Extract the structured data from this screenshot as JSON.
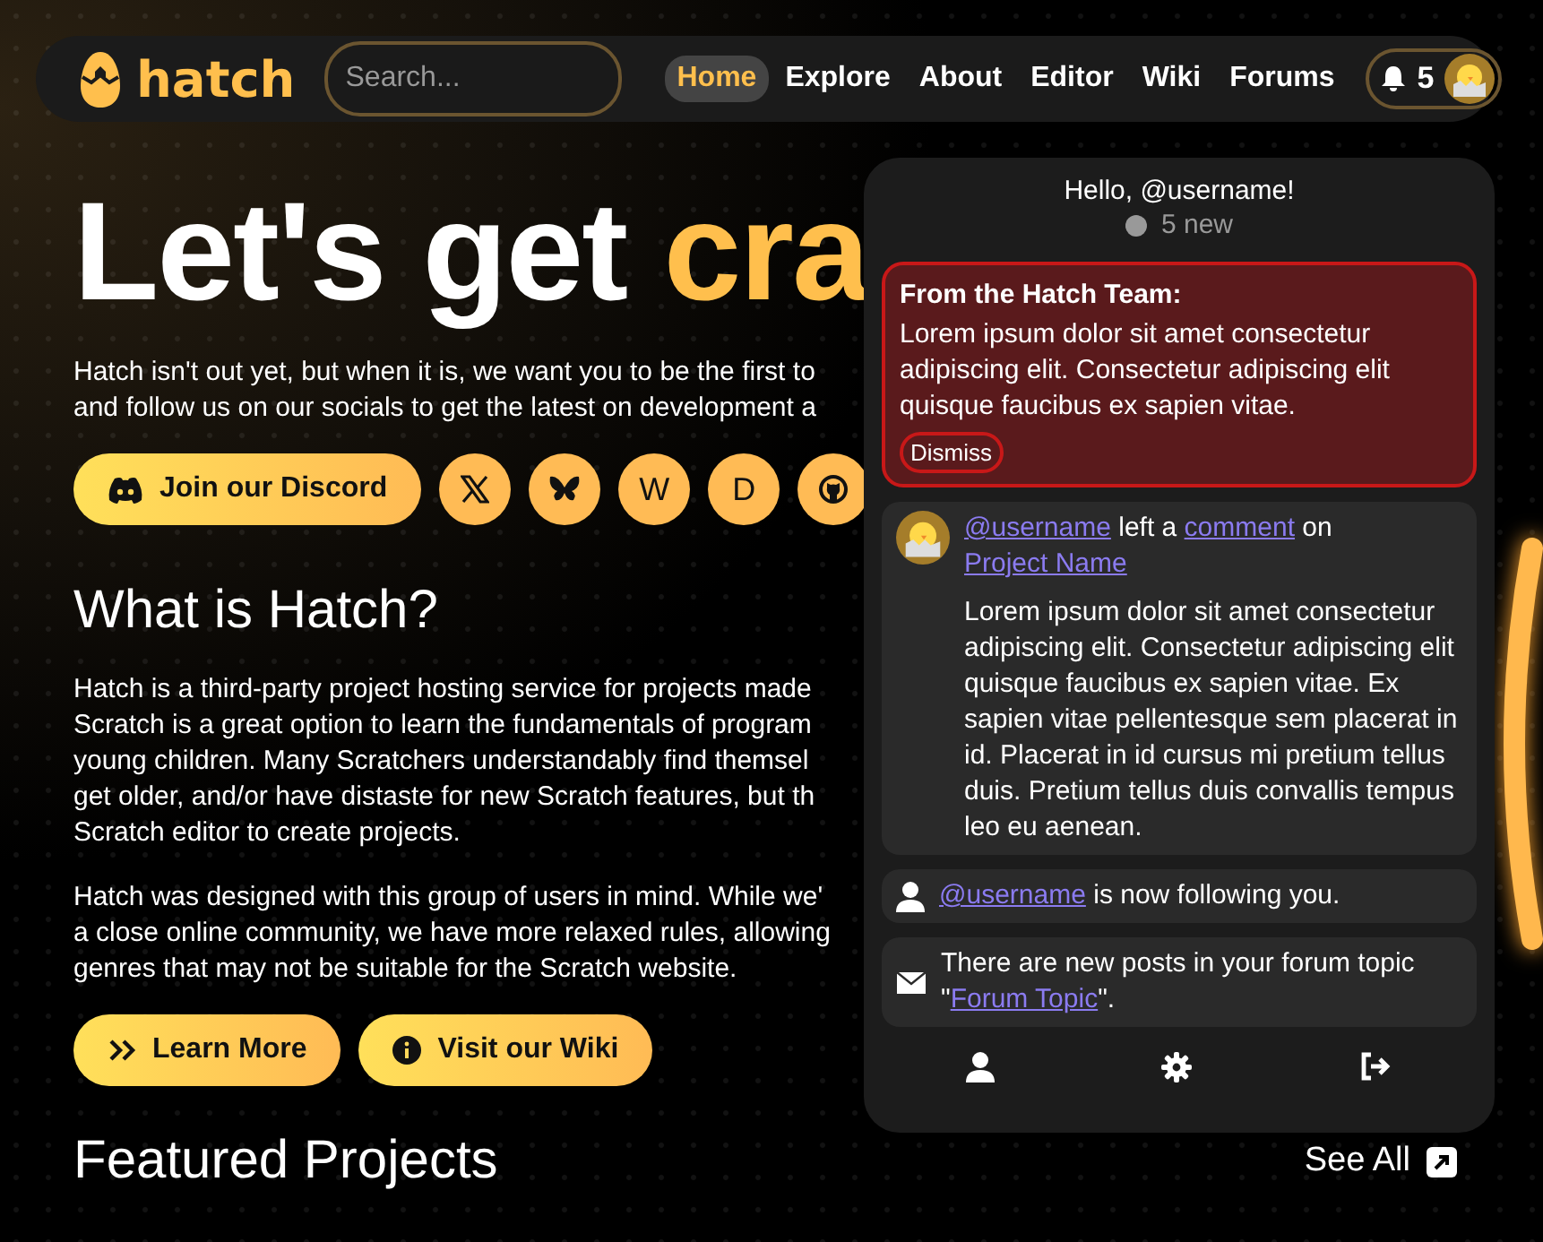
{
  "nav": {
    "logo": "hatch",
    "search": {
      "placeholder": "Search..."
    },
    "links": [
      {
        "label": "Home",
        "selected": true
      },
      {
        "label": "Explore",
        "selected": false
      },
      {
        "label": "About",
        "selected": false
      },
      {
        "label": "Editor",
        "selected": false
      },
      {
        "label": "Wiki",
        "selected": false
      },
      {
        "label": "Forums",
        "selected": false
      }
    ],
    "notification_count": "5"
  },
  "hero": {
    "title": "Let's get ",
    "title_highlight": "cra",
    "intro_lines": [
      "Hatch isn't out yet, but when it is, we want you to be the first to",
      "and follow us on our socials to get the latest on development a"
    ],
    "discord_button": "Join our Discord",
    "socials": [
      {
        "kind": "x"
      },
      {
        "kind": "butterfly"
      },
      {
        "kind": "text",
        "label": "W"
      },
      {
        "kind": "text",
        "label": "D"
      },
      {
        "kind": "github"
      }
    ]
  },
  "about": {
    "heading": "What is Hatch?",
    "paragraphs": [
      [
        "Hatch is a third-party project hosting service for projects made",
        "Scratch is a great option to learn the fundamentals of program",
        "young children. Many Scratchers understandably find themsel",
        "get older, and/or have distaste for new Scratch features, but th",
        "Scratch editor to create projects."
      ],
      [
        "Hatch was designed with this group of users in mind. While we'",
        "a close online community, we have more relaxed rules, allowing",
        "genres that may not be suitable for the Scratch website."
      ]
    ],
    "buttons": [
      {
        "kind": "learn",
        "label": "Learn More"
      },
      {
        "kind": "wiki",
        "label": "Visit our Wiki"
      }
    ]
  },
  "featured": {
    "heading": "Featured Projects",
    "see_all": "See All"
  },
  "panel": {
    "greeting": "Hello, @username!",
    "new_count": "5 new",
    "announcement": {
      "title": "From the Hatch Team:",
      "body": "Lorem ipsum dolor sit amet consectetur adipiscing elit. Consectetur adipiscing elit quisque faucibus ex sapien vitae.",
      "dismiss": "Dismiss"
    },
    "notifications": [
      {
        "kind": "comment",
        "parts": [
          {
            "text": "@username",
            "link": true
          },
          {
            "text": " left a ",
            "link": false
          },
          {
            "text": "comment",
            "link": true
          },
          {
            "text": " on ",
            "link": false
          },
          {
            "text": "Project Name",
            "link": true
          }
        ],
        "body": "Lorem ipsum dolor sit amet consectetur adipiscing elit. Consectetur adipiscing elit quisque faucibus ex sapien vitae. Ex sapien vitae pellentesque sem placerat in id. Placerat in id cursus mi pretium tellus duis. Pretium tellus duis convallis tempus leo eu aenean."
      },
      {
        "kind": "follow",
        "parts": [
          {
            "text": "@username",
            "link": true
          },
          {
            "text": " is now following you.",
            "link": false
          }
        ]
      },
      {
        "kind": "forum",
        "parts": [
          {
            "text": "There are new posts in your forum topic \"",
            "link": false
          },
          {
            "text": "Forum Topic",
            "link": true
          },
          {
            "text": "\".",
            "link": false
          }
        ]
      }
    ]
  }
}
